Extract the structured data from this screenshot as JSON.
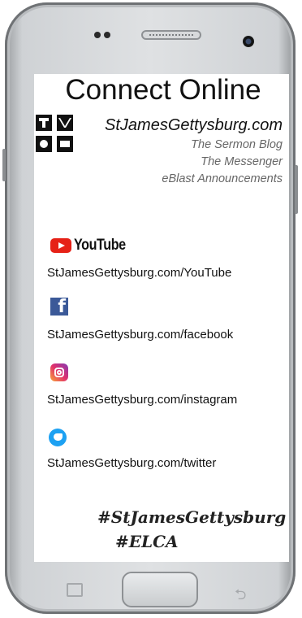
{
  "title": "Connect Online",
  "site": "StJamesGettysburg.com",
  "sub_links": [
    "The Sermon Blog",
    "The Messenger",
    "eBlast Announcements"
  ],
  "social": {
    "youtube": {
      "logo_text": "YouTube",
      "link": "StJamesGettysburg.com/YouTube"
    },
    "facebook": {
      "link": "StJamesGettysburg.com/facebook"
    },
    "instagram": {
      "link": "StJamesGettysburg.com/instagram"
    },
    "twitter": {
      "link": "StJamesGettysburg.com/twitter"
    }
  },
  "hashtags": [
    "#StJamesGettysburg",
    "#ELCA"
  ],
  "colors": {
    "youtube": "#e62117",
    "facebook": "#3b5998",
    "twitter": "#1da1f2"
  }
}
